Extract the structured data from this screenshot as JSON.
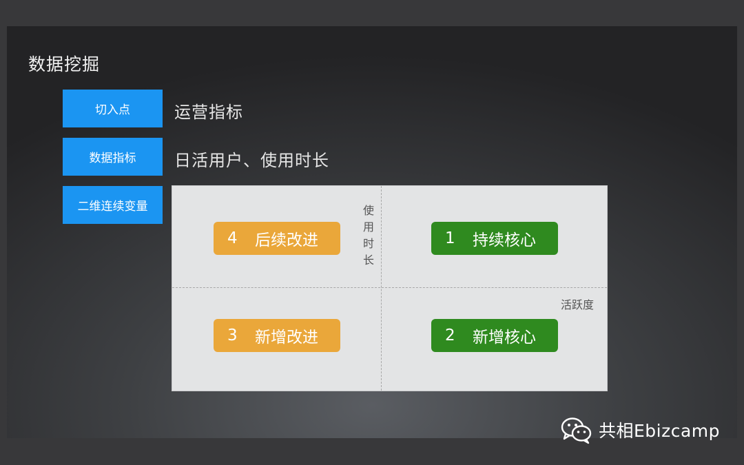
{
  "slide": {
    "title": "数据挖掘"
  },
  "rows": [
    {
      "tag": "切入点",
      "value": "运营指标"
    },
    {
      "tag": "数据指标",
      "value": "日活用户、使用时长"
    },
    {
      "tag": "二维连续变量"
    }
  ],
  "matrix": {
    "y_axis_label": [
      "使",
      "用",
      "时",
      "长"
    ],
    "x_axis_label": "活跃度",
    "quadrants": {
      "top_left": {
        "num": "4",
        "label": "后续改进",
        "color": "#eaa73a"
      },
      "top_right": {
        "num": "1",
        "label": "持续核心",
        "color": "#2f8a1f"
      },
      "bottom_left": {
        "num": "3",
        "label": "新增改进",
        "color": "#eaa73a"
      },
      "bottom_right": {
        "num": "2",
        "label": "新增核心",
        "color": "#2f8a1f"
      }
    }
  },
  "watermark": {
    "icon": "wechat-icon",
    "text": "共相Ebizcamp"
  },
  "colors": {
    "tag_bg": "#1b95f2",
    "orange": "#eaa73a",
    "green": "#2f8a1f"
  }
}
